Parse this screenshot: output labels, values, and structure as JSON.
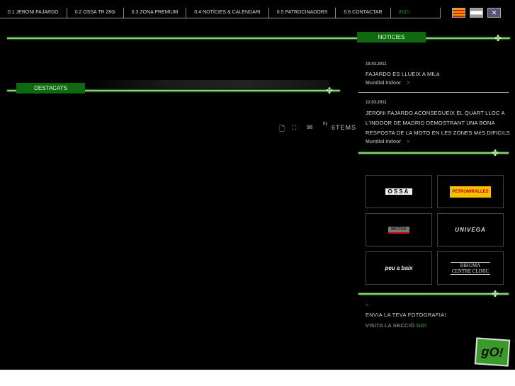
{
  "nav": {
    "items": [
      "0.1 JERONI FAJARDO",
      "0.2 OSSA TR 280i",
      "0.3 ZONA PREMIUM",
      "0.4 NOTÍCIES & CALENDARI",
      "0.5 PATROCINADORS",
      "0.6 CONTACTAR",
      "INICI"
    ]
  },
  "languages": [
    "Català",
    "Español",
    "English"
  ],
  "sections": {
    "noticies": "NOTICIES",
    "destacats": "DESTACATS"
  },
  "news": [
    {
      "date": "19.03.2011",
      "title": "FAJARDO ES LLUEIX A MILà",
      "link": "Mundial Indoor",
      "arrow": ">"
    },
    {
      "date": "12.03.2011",
      "title": "JERONI FAJARDO ACONSEGUEIX EL QUART LLOC A L'INDOOR DE MADRID DEMOSTRANT UNA BONA RESPOSTA DE LA MOTO EN LES ZONES MéS DIFICILS",
      "link": "Mundial Indoor",
      "arrow": ">"
    }
  ],
  "sponsors": [
    "OSSA",
    "PETROMIRALLES",
    "MOTOS",
    "UNIVEGA",
    "peu a baix",
    "RIHUMA CENTRE CLINIC"
  ],
  "tools": {
    "by": "by",
    "brand": "6TEMS"
  },
  "promo": {
    "arrow": ">",
    "line1": "ENVIA LA TEVA FOTOGRAFIA!",
    "line2_prefix": "VISITA LA SECCIÓ ",
    "line2_go": "GO",
    "line2_suffix": "!",
    "button": "gO!"
  }
}
